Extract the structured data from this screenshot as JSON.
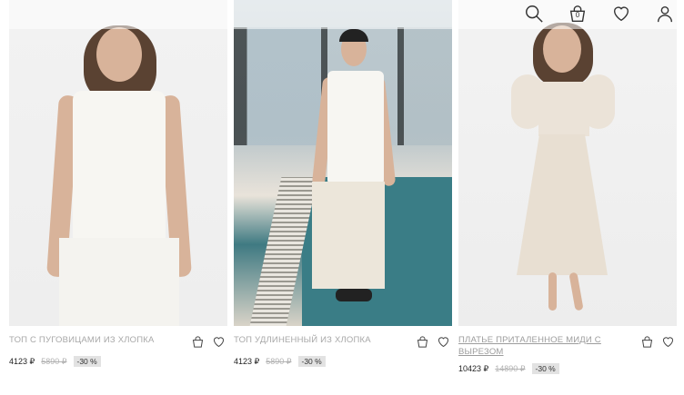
{
  "header": {
    "icons": [
      "search-icon",
      "cart-icon",
      "heart-icon",
      "user-icon"
    ],
    "cart_count": "0"
  },
  "products": [
    {
      "title": "ТОП С ПУГОВИЦАМИ ИЗ ХЛОПКА",
      "price": "4123 ₽",
      "old_price": "5890 ₽",
      "discount": "-30 %"
    },
    {
      "title": "ТОП УДЛИНЕННЫЙ ИЗ ХЛОПКА",
      "price": "4123 ₽",
      "old_price": "5890 ₽",
      "discount": "-30 %"
    },
    {
      "title": "ПЛАТЬЕ ПРИТАЛЕННОЕ МИДИ С ВЫРЕЗОМ",
      "price": "10423 ₽",
      "old_price": "14890 ₽",
      "discount": "-30 %"
    }
  ],
  "colors": {
    "text": "#333333",
    "muted": "#a8a8a8",
    "badge_bg": "#e2e2e2"
  }
}
